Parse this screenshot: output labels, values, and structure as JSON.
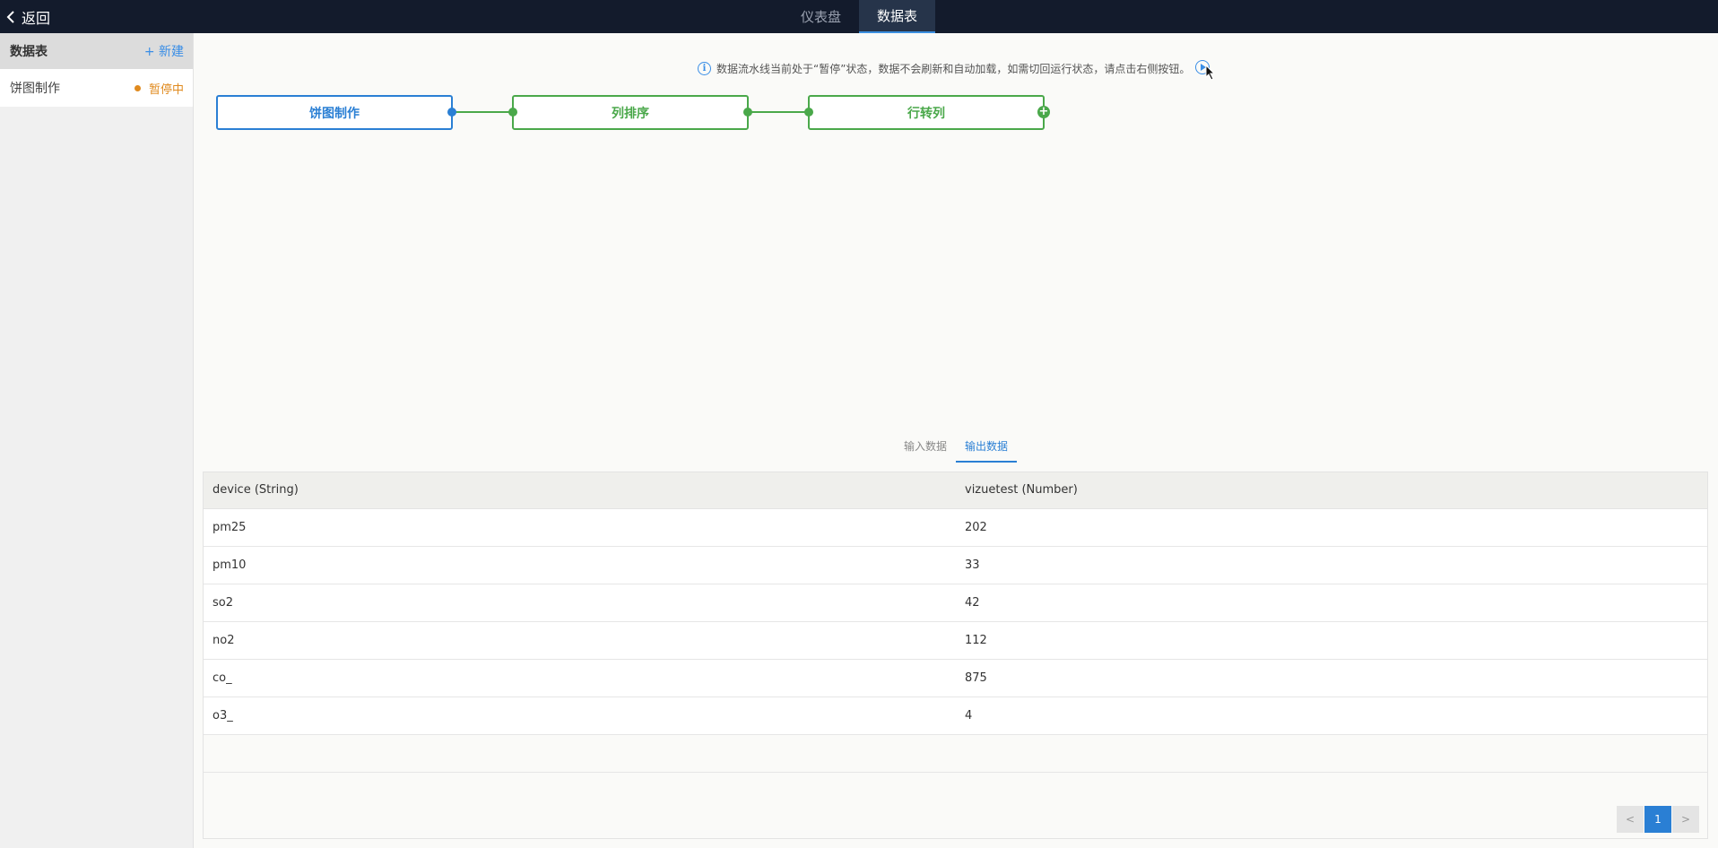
{
  "topbar": {
    "back_label": "返回",
    "tabs": [
      {
        "label": "仪表盘",
        "active": false
      },
      {
        "label": "数据表",
        "active": true
      }
    ]
  },
  "sidebar": {
    "title": "数据表",
    "new_label": "+ 新建",
    "items": [
      {
        "name": "饼图制作",
        "status": "暂停中",
        "status_color": "#e08a1e"
      }
    ]
  },
  "notice": {
    "text": "数据流水线当前处于“暂停”状态，数据不会刷新和自动加载，如需切回运行状态，请点击右侧按钮。",
    "icon": "info-icon",
    "action_icon": "play-icon"
  },
  "pipeline": {
    "nodes": [
      {
        "label": "饼图制作",
        "color": "#2a7fd4"
      },
      {
        "label": "列排序",
        "color": "#4aa84a"
      },
      {
        "label": "行转列",
        "color": "#4aa84a"
      }
    ],
    "add_icon": "plus-icon"
  },
  "data_tabs": [
    {
      "label": "输入数据",
      "active": false
    },
    {
      "label": "输出数据",
      "active": true
    }
  ],
  "table": {
    "columns": [
      "device (String)",
      "vizuetest (Number)"
    ],
    "rows": [
      [
        "pm25",
        "202"
      ],
      [
        "pm10",
        "33"
      ],
      [
        "so2",
        "42"
      ],
      [
        "no2",
        "112"
      ],
      [
        "co_",
        "875"
      ],
      [
        "o3_",
        "4"
      ]
    ]
  },
  "pagination": {
    "prev": "<",
    "current": "1",
    "next": ">"
  }
}
